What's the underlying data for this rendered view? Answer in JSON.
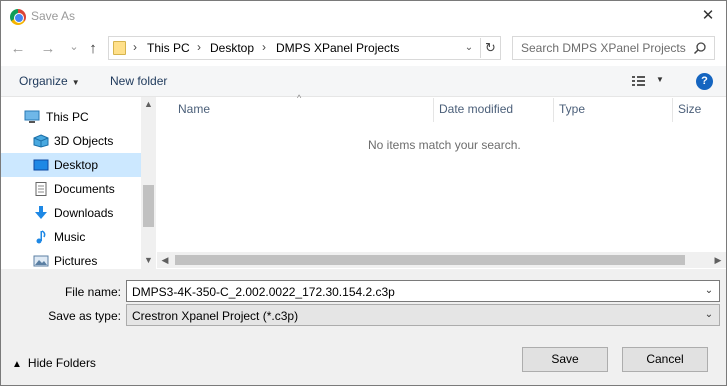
{
  "window": {
    "title": "Save As",
    "close_symbol": "✕"
  },
  "nav": {
    "back_symbol": "←",
    "forward_symbol": "→",
    "recent_symbol": "⌄",
    "up_symbol": "↑"
  },
  "address": {
    "crumbs": [
      "This PC",
      "Desktop",
      "DMPS XPanel Projects"
    ],
    "separator": "›",
    "dropdown_symbol": "⌄",
    "refresh_symbol": "↻"
  },
  "search": {
    "placeholder": "Search DMPS XPanel Projects"
  },
  "toolbar": {
    "organize_label": "Organize",
    "new_folder_label": "New folder",
    "help_label": "?"
  },
  "sidebar": {
    "items": [
      {
        "label": "This PC",
        "icon": "pc-icon"
      },
      {
        "label": "3D Objects",
        "icon": "3d-objects-icon"
      },
      {
        "label": "Desktop",
        "icon": "desktop-icon",
        "selected": true
      },
      {
        "label": "Documents",
        "icon": "documents-icon"
      },
      {
        "label": "Downloads",
        "icon": "downloads-icon"
      },
      {
        "label": "Music",
        "icon": "music-icon"
      },
      {
        "label": "Pictures",
        "icon": "pictures-icon"
      }
    ]
  },
  "filelist": {
    "columns": [
      "Name",
      "Date modified",
      "Type",
      "Size"
    ],
    "empty_message": "No items match your search."
  },
  "form": {
    "filename_label": "File name:",
    "filename_value": "DMPS3-4K-350-C_2.002.0022_172.30.154.2.c3p",
    "savetype_label": "Save as type:",
    "savetype_value": "Crestron Xpanel Project (*.c3p)"
  },
  "footer": {
    "hide_folders_label": "Hide Folders",
    "save_label": "Save",
    "cancel_label": "Cancel"
  },
  "colors": {
    "accent": "#1e395b",
    "selection": "#cce8ff",
    "help_blue": "#1565c0"
  }
}
